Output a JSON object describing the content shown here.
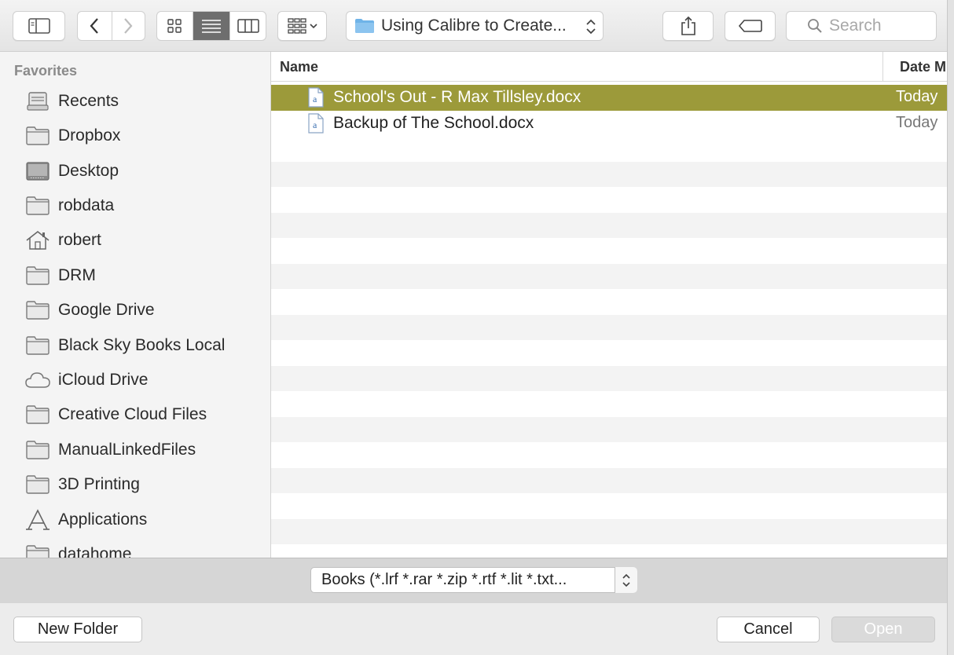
{
  "toolbar": {
    "path_label": "Using Calibre to Create...",
    "search_placeholder": "Search",
    "icons": [
      "sidebar-toggle-icon",
      "back-chevron-icon",
      "forward-chevron-icon",
      "icon-view-icon",
      "list-view-icon",
      "column-view-icon",
      "arrange-icon",
      "folder-icon",
      "share-icon",
      "tag-icon",
      "search-icon"
    ]
  },
  "sidebar": {
    "title": "Favorites",
    "items": [
      {
        "label": "Recents",
        "icon": "recents-icon"
      },
      {
        "label": "Dropbox",
        "icon": "folder-icon"
      },
      {
        "label": "Desktop",
        "icon": "desktop-icon"
      },
      {
        "label": "robdata",
        "icon": "folder-icon"
      },
      {
        "label": "robert",
        "icon": "home-icon"
      },
      {
        "label": "DRM",
        "icon": "folder-icon"
      },
      {
        "label": "Google Drive",
        "icon": "folder-icon"
      },
      {
        "label": "Black Sky Books Local",
        "icon": "folder-icon"
      },
      {
        "label": "iCloud Drive",
        "icon": "cloud-icon"
      },
      {
        "label": "Creative Cloud Files",
        "icon": "folder-icon"
      },
      {
        "label": "ManualLinkedFiles",
        "icon": "folder-icon"
      },
      {
        "label": "3D Printing",
        "icon": "folder-icon"
      },
      {
        "label": "Applications",
        "icon": "applications-icon"
      },
      {
        "label": "datahome",
        "icon": "folder-icon"
      }
    ]
  },
  "filelist": {
    "columns": {
      "name": "Name",
      "date": "Date M"
    },
    "files": [
      {
        "name": "School's Out - R Max Tillsley.docx",
        "date": "Today",
        "selected": true
      },
      {
        "name": "Backup of The School.docx",
        "date": "Today",
        "selected": false
      }
    ]
  },
  "format": {
    "label": "Books (*.lrf *.rar *.zip *.rtf *.lit *.txt..."
  },
  "buttons": {
    "new_folder": "New Folder",
    "cancel": "Cancel",
    "open": "Open"
  },
  "colors": {
    "selection": "#9c9a3a",
    "toolbar_active": "#6e6e6e",
    "folder_blue": "#6fb3e8"
  }
}
